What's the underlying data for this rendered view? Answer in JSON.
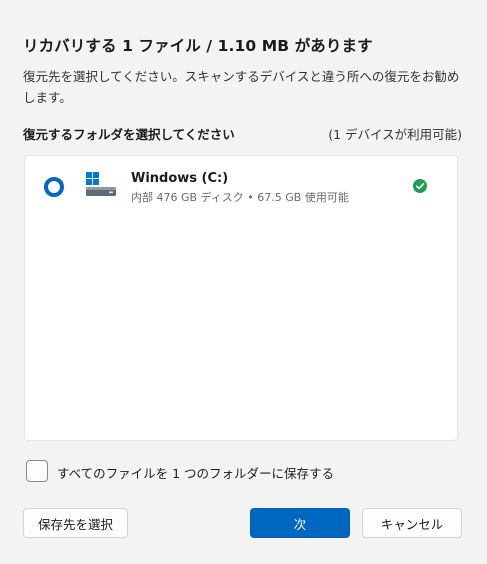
{
  "dialog": {
    "title": "リカバリする 1 ファイル / 1.10 MB があります",
    "description": "復元先を選択してください。スキャンするデバイスと違う所への復元をお勧めします。"
  },
  "folder_section": {
    "label": "復元するフォルダを選択してください",
    "device_count": "(1 デバイスが利用可能)"
  },
  "drives": [
    {
      "name": "Windows (C:)",
      "detail": "内部 476 GB ディスク • 67.5 GB 使用可能",
      "icon": "drive-icon",
      "status_icon": "check-icon"
    }
  ],
  "options": {
    "save_all_label": "すべてのファイルを 1 つのフォルダーに保存する"
  },
  "buttons": {
    "select_destination": "保存先を選択",
    "next": "次",
    "cancel": "キャンセル"
  },
  "colors": {
    "accent": "#0067c0",
    "success": "#1f9d55",
    "windows_logo": "#0078d4"
  }
}
